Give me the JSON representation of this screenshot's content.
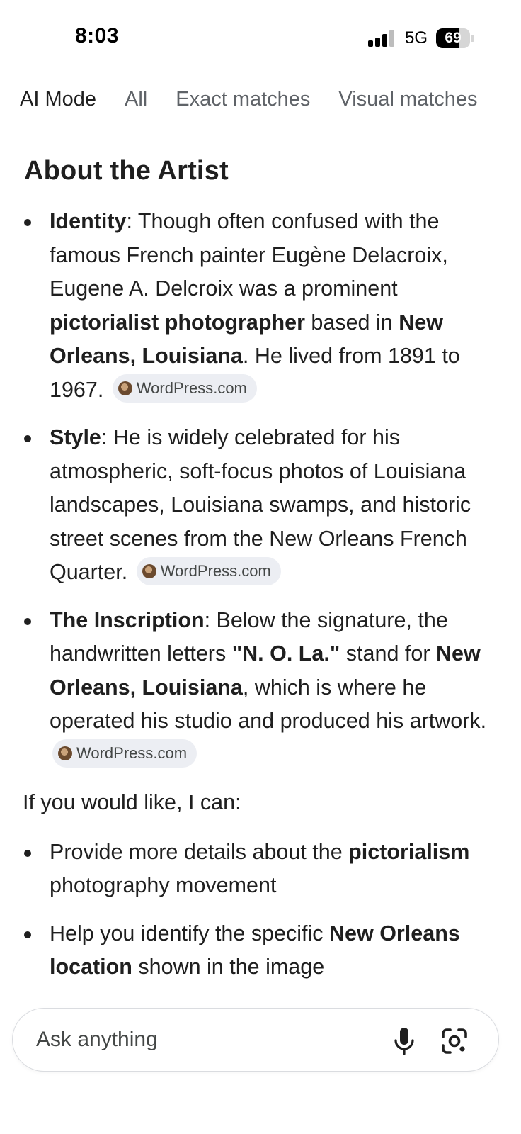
{
  "status_bar": {
    "time": "8:03",
    "network": "5G",
    "battery": "69",
    "battery_level": 0.69
  },
  "tabs": [
    {
      "label": "AI Mode",
      "active": true
    },
    {
      "label": "All",
      "active": false
    },
    {
      "label": "Exact matches",
      "active": false
    },
    {
      "label": "Visual matches",
      "active": false
    }
  ],
  "content": {
    "heading": "About the Artist",
    "bullets": [
      {
        "term": "Identity",
        "text": ": Though often confused with the famous French painter Eugène Delacroix, Eugene A. Delcroix was a prominent ",
        "bold_1": "pictorialist photographer",
        "text_2": " based in ",
        "bold_2": "New Orleans, Louisiana",
        "text_3": ". He lived from 1891 to 1967.",
        "source": "WordPress.com"
      },
      {
        "term": "Style",
        "text": ": He is widely celebrated for his atmospheric, soft-focus photos of Louisiana landscapes, Louisiana swamps, and historic street scenes from the New Orleans French Quarter.",
        "source": "WordPress.com"
      },
      {
        "term": "The Inscription",
        "text": ": Below the signature, the handwritten letters ",
        "bold_1": "\"N. O. La.\"",
        "text_2": " stand for ",
        "bold_2": "New Orleans, Louisiana",
        "text_3": ", which is where he operated his studio and produced his artwork.",
        "source": "WordPress.com"
      }
    ],
    "offer_intro": "If you would like, I can:",
    "offers": [
      {
        "text": "Provide more details about the ",
        "bold": "pictorialism",
        "text_2": " photography movement"
      },
      {
        "text": "Help you identify the specific ",
        "bold": "New Orleans location",
        "text_2": " shown in the image"
      }
    ]
  },
  "ask_bar": {
    "placeholder": "Ask anything",
    "icons": [
      "microphone-icon",
      "google-lens-icon"
    ]
  },
  "colors": {
    "text": "#1f1f1f",
    "muted": "#5f6368",
    "chip_bg": "#eceef3"
  }
}
